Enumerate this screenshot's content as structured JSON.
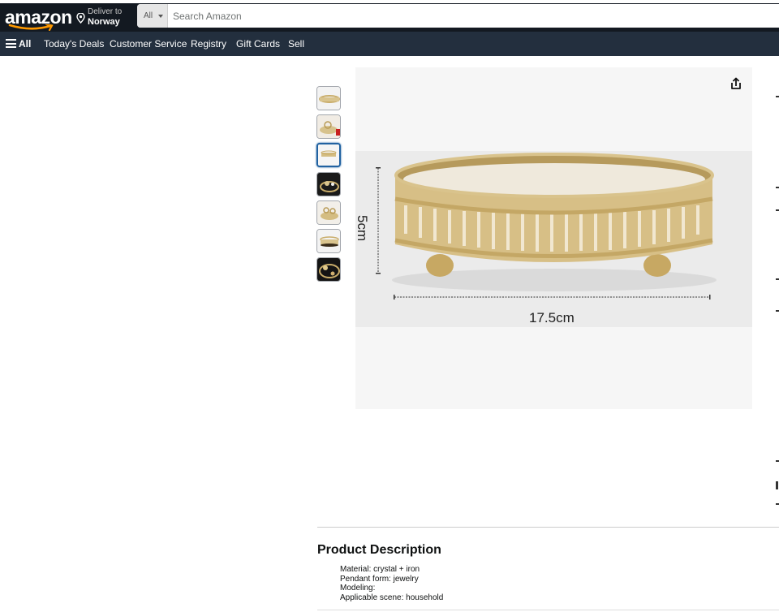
{
  "header": {
    "logo_text": "amazon",
    "deliver_line1": "Deliver to",
    "deliver_line2": "Norway",
    "search_category": "All",
    "search_placeholder": "Search Amazon"
  },
  "nav": {
    "all_label": "All",
    "items": [
      "Today's Deals",
      "Customer Service",
      "Registry",
      "Gift Cards",
      "Sell"
    ]
  },
  "gallery": {
    "thumbnail_count": 7,
    "selected_index": 2,
    "main_image": {
      "height_label": "5cm",
      "width_label": "17.5cm"
    }
  },
  "product_description": {
    "title": "Product Description",
    "lines": [
      "Material: crystal + iron",
      "Pendant form: jewelry",
      "Modeling:",
      "Applicable scene: household"
    ]
  },
  "colors": {
    "topbar": "#131921",
    "navbar": "#232f3e",
    "accent_orange": "#ff9900",
    "selected_thumb": "#2162a1",
    "gold": "#c9ad6a"
  }
}
